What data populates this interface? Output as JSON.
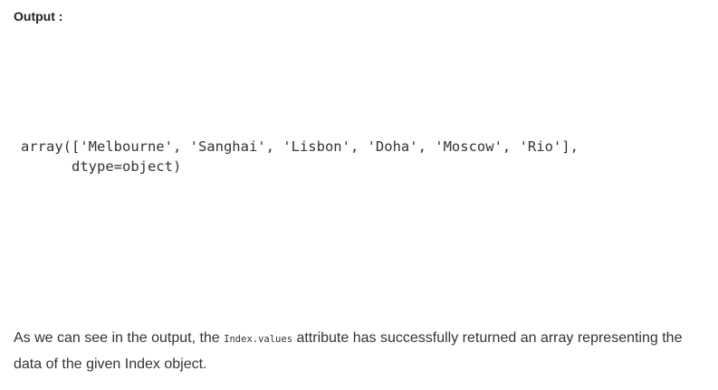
{
  "heading": "Output :",
  "code_output": {
    "line1": "array(['Melbourne', 'Sanghai', 'Lisbon', 'Doha', 'Moscow', 'Rio'],",
    "line2": "      dtype=object)"
  },
  "paragraph": {
    "text_before": "As we can see in the output, the ",
    "code": "Index.values",
    "text_after": " attribute has successfully returned an array representing the data of the given Index object."
  }
}
